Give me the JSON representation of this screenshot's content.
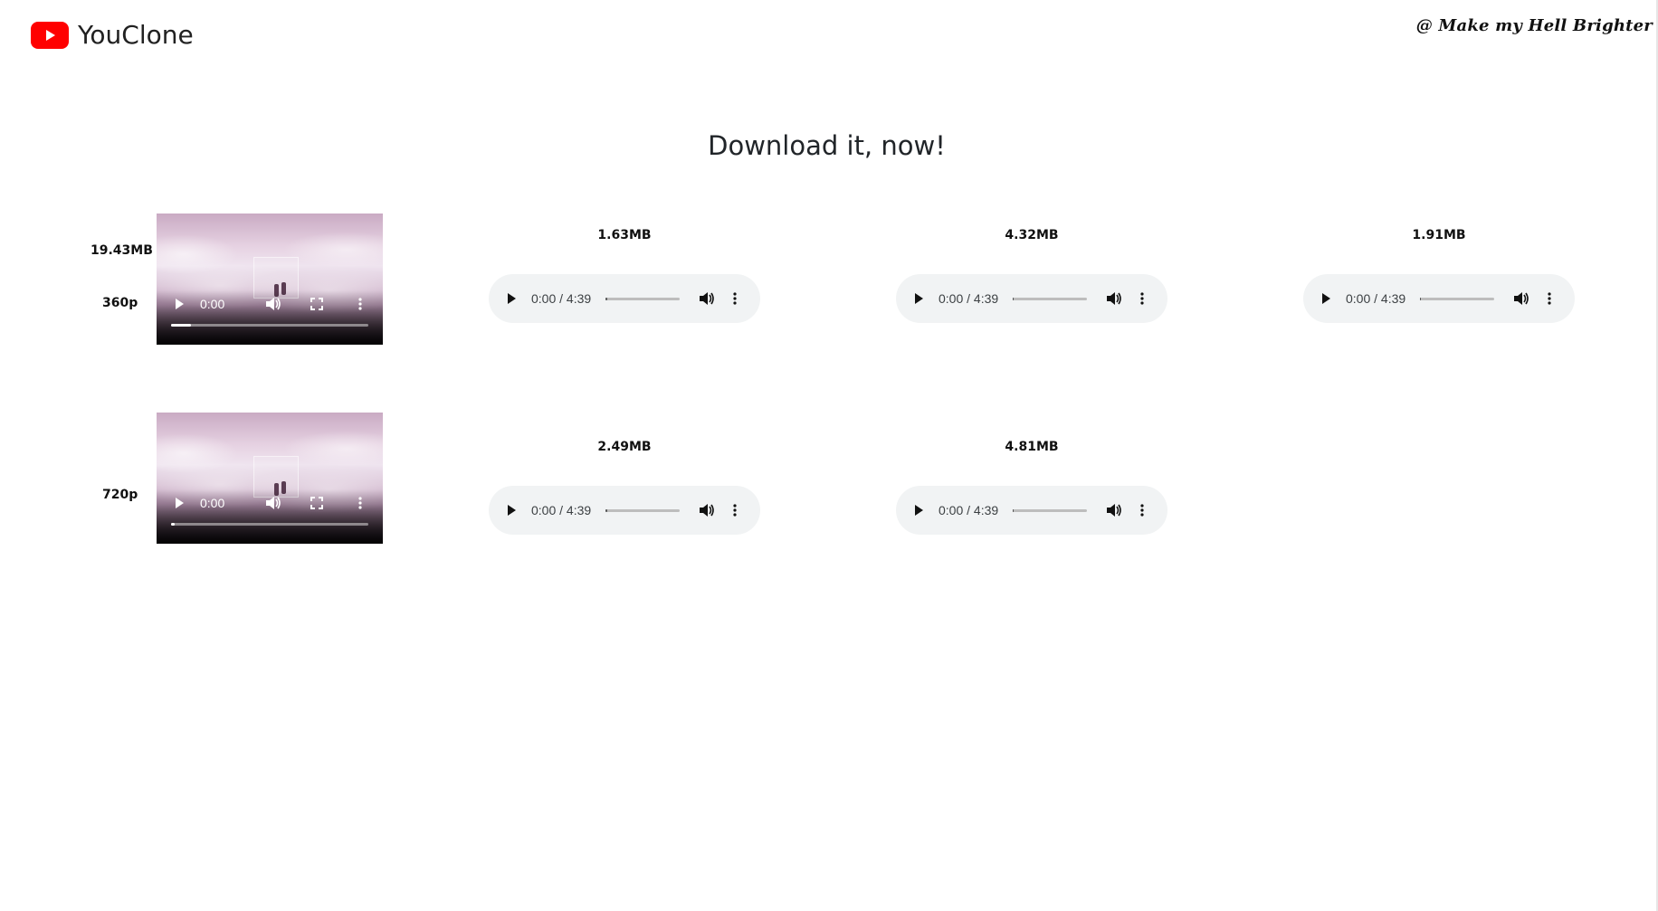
{
  "header": {
    "brand_name": "YouClone",
    "logo_icon": "youtube-play-icon",
    "brand_color": "#ff0000",
    "credit": "@ Make my Hell Brighter"
  },
  "heading": "Download it, now!",
  "video_rows": [
    {
      "size": "19.43MB",
      "resolution": "360p",
      "player": {
        "time": "0:00",
        "progress": 0.1
      },
      "audio_files": [
        {
          "size": "1.63MB",
          "time": "0:00 / 4:39",
          "progress": 0.03
        },
        {
          "size": "4.32MB",
          "time": "0:00 / 4:39",
          "progress": 0.01
        },
        {
          "size": "1.91MB",
          "time": "0:00 / 4:39",
          "progress": 0.01
        }
      ]
    },
    {
      "size": "",
      "resolution": "720p",
      "player": {
        "time": "0:00",
        "progress": 0.02
      },
      "audio_files": [
        {
          "size": "2.49MB",
          "time": "0:00 / 4:39",
          "progress": 0.02
        },
        {
          "size": "4.81MB",
          "time": "0:00 / 4:39",
          "progress": 0.01
        }
      ]
    }
  ]
}
